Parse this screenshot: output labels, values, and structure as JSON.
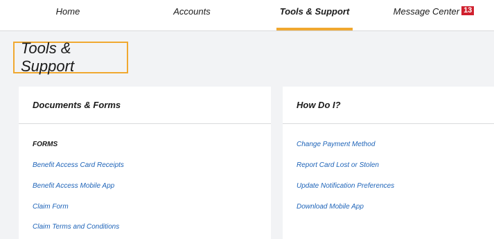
{
  "nav": {
    "items": [
      {
        "label": "Home"
      },
      {
        "label": "Accounts"
      },
      {
        "label": "Tools & Support"
      },
      {
        "label": "Message Center"
      }
    ],
    "message_count": "13",
    "accent_color": "#f0a830",
    "badge_color": "#d0202e"
  },
  "page": {
    "title": "Tools & Support"
  },
  "documents_forms": {
    "heading": "Documents & Forms",
    "section_label": "FORMS",
    "links": [
      "Benefit Access Card Receipts",
      "Benefit Access Mobile App",
      "Claim Form",
      "Claim Terms and Conditions"
    ]
  },
  "how_do_i": {
    "heading": "How Do I?",
    "links": [
      "Change Payment Method",
      "Report Card Lost or Stolen",
      "Update Notification Preferences",
      "Download Mobile App"
    ]
  },
  "colors": {
    "link": "#1d63b8",
    "background": "#f2f3f5"
  }
}
